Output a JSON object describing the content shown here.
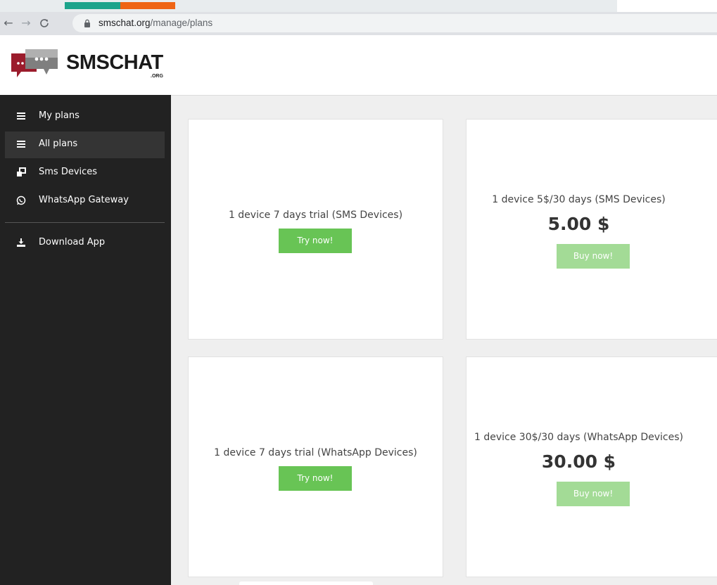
{
  "browser": {
    "url_domain": "smschat.org",
    "url_path": "/manage/plans",
    "tab_colors": [
      "#1ca38b",
      "#ef6414"
    ]
  },
  "header": {
    "logo_text": "SMSCHAT",
    "logo_sub": ".ORG"
  },
  "sidebar": {
    "items": [
      {
        "label": "My plans",
        "icon": "list-icon",
        "active": false
      },
      {
        "label": "All plans",
        "icon": "list-icon",
        "active": true
      },
      {
        "label": "Sms Devices",
        "icon": "devices-icon",
        "active": false
      },
      {
        "label": "WhatsApp Gateway",
        "icon": "whatsapp-icon",
        "active": false
      },
      {
        "label": "Download App",
        "icon": "download-icon",
        "active": false
      }
    ]
  },
  "plans": [
    {
      "title": "1 device 7 days trial (SMS Devices)",
      "price": "",
      "button": "Try now!"
    },
    {
      "title": "1 device 5$/30 days (SMS Devices)",
      "price": "5.00 $",
      "button": "Buy now!"
    },
    {
      "title": "1 device 7 days trial (WhatsApp Devices)",
      "price": "",
      "button": "Try now!"
    },
    {
      "title": "1 device 30$/30 days (WhatsApp Devices)",
      "price": "30.00 $",
      "button": "Buy now!"
    }
  ],
  "colors": {
    "sidebar_bg": "#222222",
    "sidebar_active": "#343434",
    "try_button": "#68c455",
    "buy_button": "#a3db96",
    "main_bg": "#efefef"
  }
}
